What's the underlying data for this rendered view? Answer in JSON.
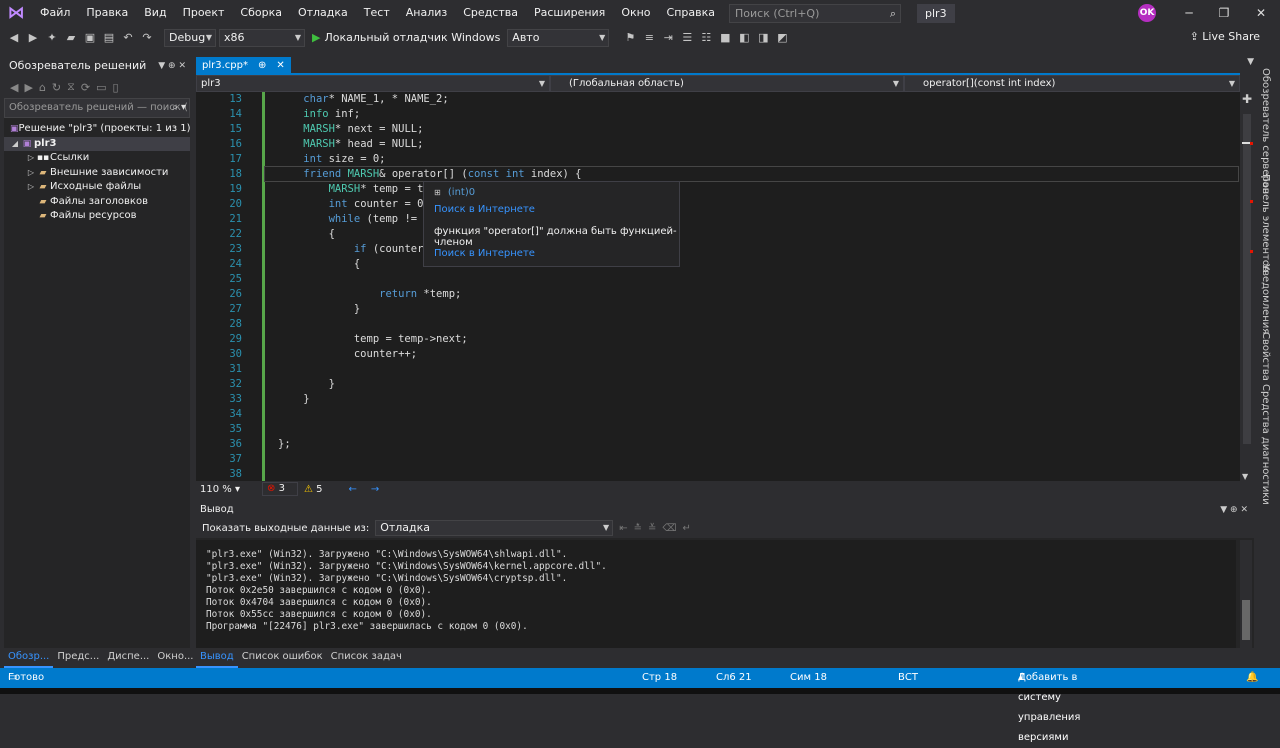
{
  "menu": {
    "items": [
      "Файл",
      "Правка",
      "Вид",
      "Проект",
      "Сборка",
      "Отладка",
      "Тест",
      "Анализ",
      "Средства",
      "Расширения",
      "Окно",
      "Справка"
    ],
    "search_placeholder": "Поиск (Ctrl+Q)",
    "project_title": "plr3",
    "avatar": "OK"
  },
  "toolbar": {
    "config": "Debug",
    "platform": "x86",
    "run_label": "Локальный отладчик Windows",
    "mode": "Авто",
    "live_share": "Live Share"
  },
  "solution_explorer": {
    "title": "Обозреватель решений",
    "search_placeholder": "Обозреватель решений — поиск (",
    "items": [
      {
        "label": "Решение \"plr3\" (проекты: 1 из 1)",
        "indent": 0
      },
      {
        "label": "plr3",
        "indent": 1
      },
      {
        "label": "Ссылки",
        "indent": 2
      },
      {
        "label": "Внешние зависимости",
        "indent": 2
      },
      {
        "label": "Исходные файлы",
        "indent": 2
      },
      {
        "label": "Файлы заголовков",
        "indent": 2
      },
      {
        "label": "Файлы ресурсов",
        "indent": 2
      }
    ],
    "bottom_tabs": [
      "Обозр...",
      "Предс...",
      "Диспе...",
      "Окно..."
    ]
  },
  "editor": {
    "tab_label": "plr3.cpp*",
    "tab_pin": "⊕",
    "tab_close": "✕",
    "nav_project": "plr3",
    "nav_scope": "(Глобальная область)",
    "nav_member": "operator[](const int index)",
    "lines": [
      {
        "n": "13",
        "code": "    char* NAME_1, * NAME_2;"
      },
      {
        "n": "14",
        "code": "    info inf;"
      },
      {
        "n": "15",
        "code": "    MARSH* next = NULL;"
      },
      {
        "n": "16",
        "code": "    MARSH* head = NULL;"
      },
      {
        "n": "17",
        "code": "    int size = 0;"
      },
      {
        "n": "18",
        "code": "    friend MARSH& operator[] (const int index) {"
      },
      {
        "n": "19",
        "code": "        MARSH* temp = th"
      },
      {
        "n": "20",
        "code": "        int counter = 0"
      },
      {
        "n": "21",
        "code": "        while (temp != N"
      },
      {
        "n": "22",
        "code": "        {"
      },
      {
        "n": "23",
        "code": "            if (counter"
      },
      {
        "n": "24",
        "code": "            {"
      },
      {
        "n": "25",
        "code": ""
      },
      {
        "n": "26",
        "code": "                return *temp;"
      },
      {
        "n": "27",
        "code": "            }"
      },
      {
        "n": "28",
        "code": ""
      },
      {
        "n": "29",
        "code": "            temp = temp->next;"
      },
      {
        "n": "30",
        "code": "            counter++;"
      },
      {
        "n": "31",
        "code": ""
      },
      {
        "n": "32",
        "code": "        }"
      },
      {
        "n": "33",
        "code": "    }"
      },
      {
        "n": "34",
        "code": ""
      },
      {
        "n": "35",
        "code": ""
      },
      {
        "n": "36",
        "code": "};"
      },
      {
        "n": "37",
        "code": ""
      },
      {
        "n": "38",
        "code": ""
      }
    ],
    "tooltip": {
      "type": "(int)0",
      "link1": "Поиск в Интернете",
      "message": "функция \"operator[]\" должна быть функцией-членом",
      "link2": "Поиск в Интернете"
    },
    "zoom": "110 %",
    "errors": "3",
    "warnings": "5"
  },
  "output": {
    "title": "Вывод",
    "show_from_label": "Показать выходные данные из:",
    "source": "Отладка",
    "lines": [
      "\"plr3.exe\" (Win32). Загружено \"C:\\Windows\\SysWOW64\\shlwapi.dll\".",
      "\"plr3.exe\" (Win32). Загружено \"C:\\Windows\\SysWOW64\\kernel.appcore.dll\".",
      "\"plr3.exe\" (Win32). Загружено \"C:\\Windows\\SysWOW64\\cryptsp.dll\".",
      "Поток 0x2e50 завершился с кодом 0 (0x0).",
      "Поток 0x4704 завершился с кодом 0 (0x0).",
      "Поток 0x55cc завершился с кодом 0 (0x0).",
      "Программа \"[22476] plr3.exe\" завершилась с кодом 0 (0x0)."
    ],
    "tabs": [
      "Вывод",
      "Список ошибок",
      "Список задач"
    ]
  },
  "right_rail": [
    "Обозреватель серверов",
    "Панель элементов",
    "Уведомления",
    "Свойства",
    "Средства диагностики"
  ],
  "status": {
    "ready": "Готово",
    "line": "Стр 18",
    "col": "Сл6 21",
    "char": "Сим 18",
    "ins": "ВСТ",
    "vcs": "Добавить в систему управления версиями"
  }
}
